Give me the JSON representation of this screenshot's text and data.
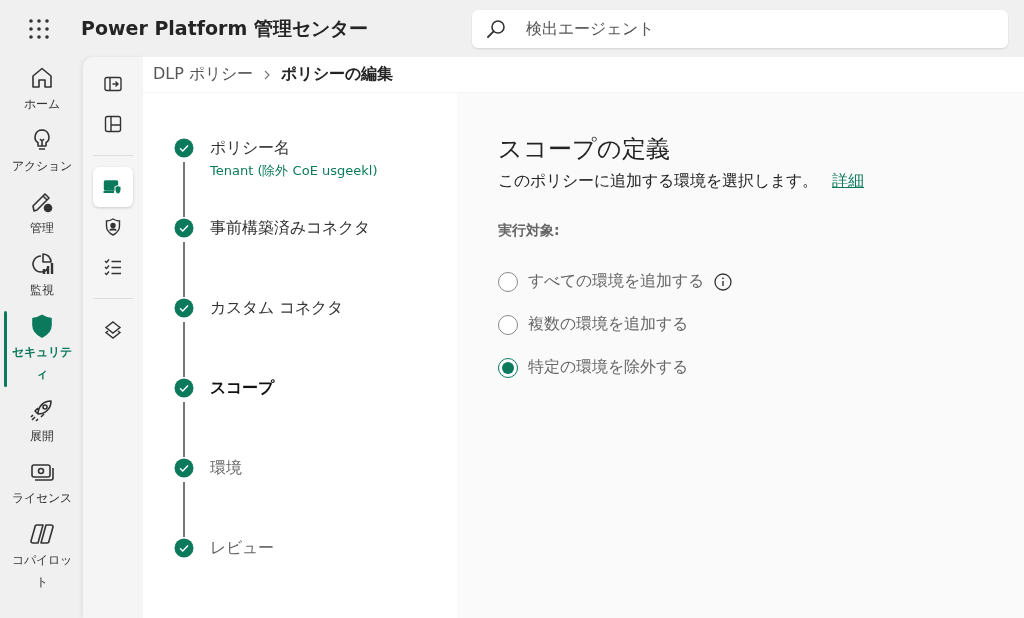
{
  "header": {
    "title": "Power Platform 管理センター",
    "search": {
      "placeholder": "検出エージェント"
    }
  },
  "nav": [
    {
      "label": "ホーム",
      "selected": false
    },
    {
      "label": "アクション",
      "selected": false
    },
    {
      "label": "管理",
      "selected": false
    },
    {
      "label": "監視",
      "selected": false
    },
    {
      "label": "セキュリティ",
      "selected": true
    },
    {
      "label": "展開",
      "selected": false
    },
    {
      "label": "ライセンス",
      "selected": false
    },
    {
      "label": "コパイロット",
      "selected": false
    }
  ],
  "rail": [
    {
      "selected": false
    },
    {
      "selected": false
    },
    {
      "selected": true
    },
    {
      "selected": false
    },
    {
      "selected": false
    },
    {
      "selected": false
    }
  ],
  "breadcrumb": [
    "DLP ポリシー",
    "ポリシーの編集"
  ],
  "steps": [
    {
      "label": "ポリシー名",
      "sub": "Tenant (除外 CoE usgeekl)",
      "selected": false,
      "disabled": false
    },
    {
      "label": "事前構築済みコネクタ",
      "selected": false,
      "disabled": false
    },
    {
      "label": "カスタム コネクタ",
      "selected": false,
      "disabled": false
    },
    {
      "label": "スコープ",
      "selected": true,
      "disabled": false
    },
    {
      "label": "環境",
      "selected": false,
      "disabled": true
    },
    {
      "label": "レビュー",
      "selected": false,
      "disabled": true
    }
  ],
  "content": {
    "title": "スコープの定義",
    "description": "このポリシーに追加する環境を選択します。",
    "link": "詳細",
    "group_label": "実行対象:",
    "options": [
      {
        "label": "すべての環境を追加する",
        "selected": false,
        "info": true
      },
      {
        "label": "複数の環境を追加する",
        "selected": false,
        "info": false
      },
      {
        "label": "特定の環境を除外する",
        "selected": true,
        "info": false
      }
    ]
  }
}
